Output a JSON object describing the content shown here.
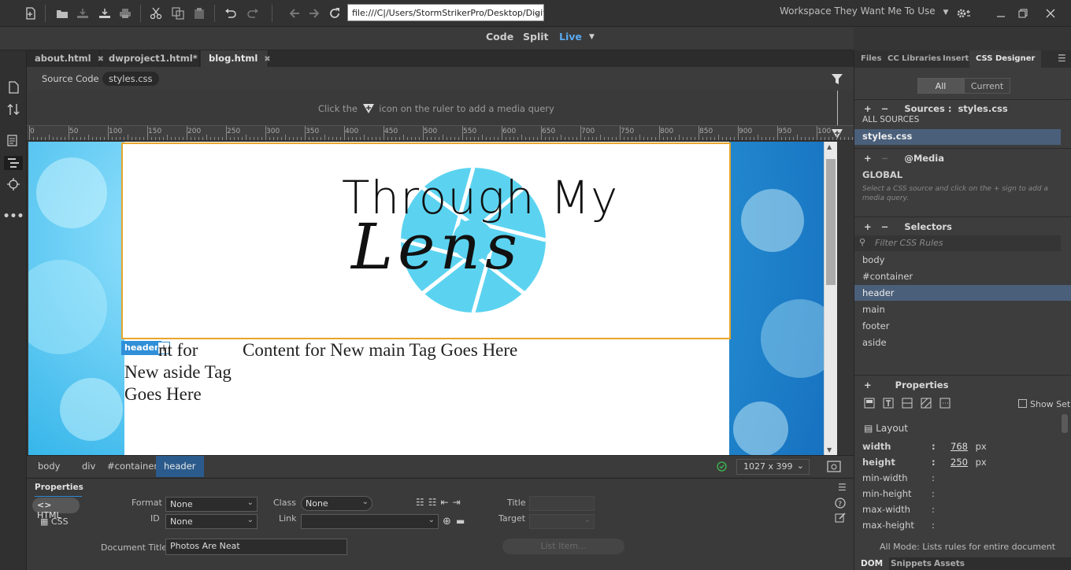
{
  "toolbar": {
    "url": "file:///C|/Users/StormStrikerPro/Desktop/Digita",
    "workspace": "Workspace They Want Me To Use"
  },
  "view_switcher": {
    "code": "Code",
    "split": "Split",
    "live": "Live"
  },
  "document_tabs": [
    {
      "label": "about.html"
    },
    {
      "label": "dwproject1.html*"
    },
    {
      "label": "blog.html"
    }
  ],
  "related_files": {
    "source_code": "Source Code",
    "styles": "styles.css"
  },
  "media_query_hint": {
    "before": "Click the",
    "after": "icon on the ruler to add a media query"
  },
  "ruler_ticks": [
    "0",
    "50",
    "100",
    "150",
    "200",
    "250",
    "300",
    "350",
    "400",
    "450",
    "500",
    "550",
    "600",
    "650",
    "700",
    "750",
    "800",
    "850",
    "900",
    "950",
    "100"
  ],
  "page": {
    "logo_line1": "Through My",
    "logo_line2": "Lens",
    "aside_text": "Content for New aside Tag Goes Here",
    "aside_visible": "nt for",
    "aside_line2": "New aside Tag",
    "aside_line3": "Goes Here",
    "main_text": "Content for New main Tag Goes Here",
    "header_tag": "header"
  },
  "breadcrumbs": [
    "body",
    "div",
    "#container",
    "header"
  ],
  "status": {
    "dimensions": "1027 x 399"
  },
  "properties": {
    "title": "Properties",
    "html_btn": "HTML",
    "css_btn": "CSS",
    "format_label": "Format",
    "format_value": "None",
    "id_label": "ID",
    "id_value": "None",
    "class_label": "Class",
    "class_value": "None",
    "link_label": "Link",
    "link_value": "",
    "title_label": "Title",
    "target_label": "Target",
    "doc_title_label": "Document Title",
    "doc_title_value": "Photos Are Neat",
    "list_item": "List Item..."
  },
  "right_panel": {
    "tabs": [
      "Files",
      "CC Libraries",
      "Insert",
      "CSS Designer"
    ],
    "all": "All",
    "current": "Current",
    "sources_title": "Sources :",
    "sources_file": "styles.css",
    "sources": [
      "ALL SOURCES",
      "styles.css"
    ],
    "media_title": "@Media",
    "media_global": "GLOBAL",
    "media_hint": "Select a CSS source and click on the + sign to add a media query.",
    "selectors_title": "Selectors",
    "filter_placeholder": "Filter CSS Rules",
    "selectors": [
      "body",
      "#container",
      "header",
      "main",
      "footer",
      "aside"
    ],
    "properties_title": "Properties",
    "show_set": "Show Set",
    "layout": "Layout",
    "props": [
      {
        "name": "width",
        "value": "768",
        "unit": "px"
      },
      {
        "name": "height",
        "value": "250",
        "unit": "px"
      },
      {
        "name": "min-width",
        "value": "",
        "unit": ""
      },
      {
        "name": "min-height",
        "value": "",
        "unit": ""
      },
      {
        "name": "max-width",
        "value": "",
        "unit": ""
      },
      {
        "name": "max-height",
        "value": "",
        "unit": ""
      }
    ],
    "mode_hint": "All Mode: Lists rules for entire document",
    "bottom_tabs": [
      "DOM",
      "Snippets",
      "Assets"
    ]
  },
  "colors": {
    "accent": "#2f8fd8",
    "selection": "#e8a52c",
    "logo_blue": "#5bd3f0"
  }
}
